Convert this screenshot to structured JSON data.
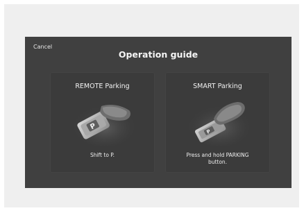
{
  "header": {
    "cancel_label": "Cancel",
    "title": "Operation guide"
  },
  "cards": [
    {
      "title": "REMOTE Parking",
      "icon": "smart-key-p-button-icon",
      "caption_line1": "Shift to P.",
      "caption_line2": ""
    },
    {
      "title": "SMART Parking",
      "icon": "press-parking-button-icon",
      "caption_line1": "Press and hold PARKING",
      "caption_line2": "button."
    }
  ],
  "colors": {
    "screen_bg": "#404040",
    "card_bg": "#3b3b3b",
    "page_bg": "#efefef",
    "text": "#f2f2f2"
  }
}
